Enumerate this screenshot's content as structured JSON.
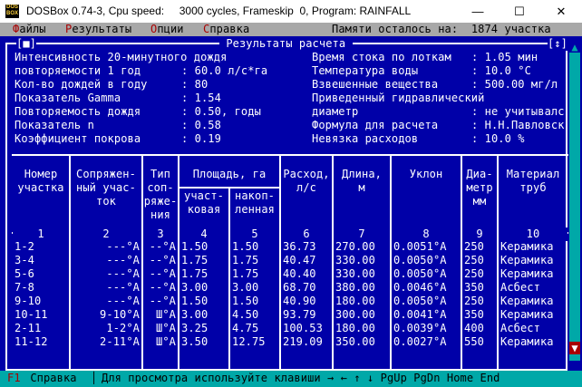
{
  "window": {
    "title": "DOSBox 0.74-3, Cpu speed:     3000 cycles, Frameskip  0, Program: RAINFALL",
    "minimize": "—",
    "maximize": "☐",
    "close": "✕"
  },
  "menu": {
    "items": [
      {
        "hot": "Ф",
        "rest": "айлы"
      },
      {
        "hot": "Р",
        "rest": "езультаты"
      },
      {
        "hot": "О",
        "rest": "пции"
      },
      {
        "hot": "С",
        "rest": "правка"
      }
    ],
    "memory": "Памяти осталось на:  1874 участка"
  },
  "panel": {
    "close_box": "[■]",
    "title": " Результаты расчета ",
    "resize_box": "[↕]"
  },
  "params_left": [
    {
      "label": "Интенсивность 20-минутного дождя",
      "value": ""
    },
    {
      "label": "повторяемости 1 год",
      "value": ": 60.0 л/с*га"
    },
    {
      "label": "Кол-во дождей в году",
      "value": ": 80"
    },
    {
      "label": "Показатель Gamma",
      "value": ": 1.54"
    },
    {
      "label": "Повторяемость дождя",
      "value": ": 0.50, годы"
    },
    {
      "label": "Показатель n",
      "value": ": 0.58"
    },
    {
      "label": "Коэффициент покрова",
      "value": ": 0.19"
    }
  ],
  "params_right": [
    {
      "label": "Время стока по лоткам",
      "value": ": 1.05 мин"
    },
    {
      "label": "Температура воды",
      "value": ": 10.0 °C"
    },
    {
      "label": "Взвешенные вещества",
      "value": ": 500.00 мг/л"
    },
    {
      "label": "Приведенный гидравлический",
      "value": ""
    },
    {
      "label": "диаметр",
      "value": ": не учитывалс"
    },
    {
      "label": "Формула для расчета",
      "value": ": Н.Н.Павловск"
    },
    {
      "label": "Невязка расходов",
      "value": ": 10.0 %"
    }
  ],
  "table": {
    "headers": {
      "num": "Номер\nучастка",
      "conj": "Сопряжен-\nный учас-\nток",
      "type": "Тип\nсоп-\nряже-\nния",
      "area": "Площадь, га",
      "area_sect": "участ-\nковая",
      "area_acc": "накоп-\nленная",
      "flow": "Расход,\nл/с",
      "length": "Длина,\nм",
      "slope": "Уклон",
      "diam": "Диа-\nметр\nмм",
      "material": "Материал\nтруб"
    },
    "col_numbers": [
      "1",
      "2",
      "3",
      "4",
      "5",
      "6",
      "7",
      "8",
      "9",
      "10"
    ],
    "rows": [
      [
        "1-2",
        "---°A",
        "--°A",
        "1.50",
        "1.50",
        "36.73",
        "270.00",
        "0.0051°A",
        "250",
        "Керамика"
      ],
      [
        "3-4",
        "---°A",
        "--°A",
        "1.75",
        "1.75",
        "40.47",
        "330.00",
        "0.0050°A",
        "250",
        "Керамика"
      ],
      [
        "5-6",
        "---°A",
        "--°A",
        "1.75",
        "1.75",
        "40.40",
        "330.00",
        "0.0050°A",
        "250",
        "Керамика"
      ],
      [
        "7-8",
        "---°A",
        "--°A",
        "3.00",
        "3.00",
        "68.70",
        "380.00",
        "0.0046°A",
        "350",
        "Асбест"
      ],
      [
        "9-10",
        "---°A",
        "--°A",
        "1.50",
        "1.50",
        "40.90",
        "180.00",
        "0.0050°A",
        "250",
        "Керамика"
      ],
      [
        "10-11",
        "9-10°A",
        "Ш°A",
        "3.00",
        "4.50",
        "93.79",
        "300.00",
        "0.0041°A",
        "350",
        "Керамика"
      ],
      [
        "2-11",
        "1-2°A",
        "Ш°A",
        "3.25",
        "4.75",
        "100.53",
        "180.00",
        "0.0039°A",
        "400",
        "Асбест"
      ],
      [
        "11-12",
        "2-11°A",
        "Ш°A",
        "3.50",
        "12.75",
        "219.09",
        "350.00",
        "0.0027°A",
        "550",
        "Керамика"
      ]
    ]
  },
  "status": {
    "key": "F1",
    "key_label": " Справка",
    "hint": "Для просмотра используйте клавиши → ← ↑ ↓ PgUp PgDn Home End"
  },
  "scrollbar": {
    "up": "▲",
    "down": "▼"
  }
}
